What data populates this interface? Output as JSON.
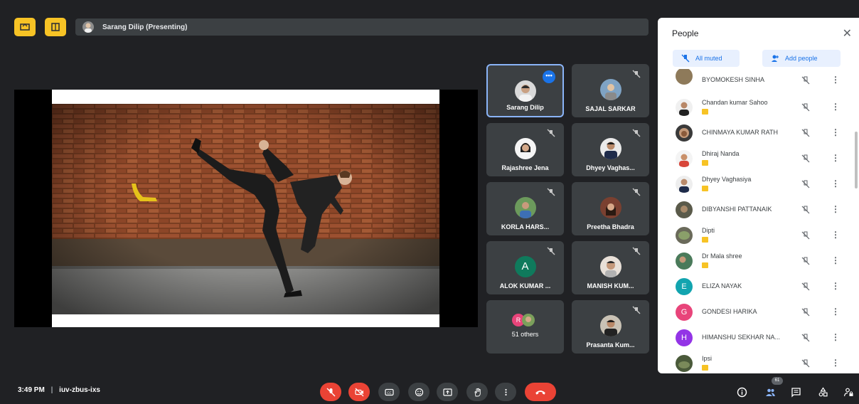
{
  "top_bar": {
    "presenter_label": "Sarang Dilip (Presenting)"
  },
  "tiles": [
    {
      "name": "Sarang Dilip",
      "active": true,
      "more": "•••"
    },
    {
      "name": "SAJAL SARKAR"
    },
    {
      "name": "Rajashree Jena"
    },
    {
      "name": "Dhyey Vaghas..."
    },
    {
      "name": "KORLA HARS..."
    },
    {
      "name": "Preetha Bhadra"
    },
    {
      "name": "ALOK KUMAR ...",
      "initial": "A"
    },
    {
      "name": "MANISH KUM..."
    },
    {
      "name": "51 others",
      "initial": "R"
    },
    {
      "name": "Prasanta Kum..."
    }
  ],
  "people_panel": {
    "title": "People",
    "close_icon": "✕",
    "all_muted_label": "All muted",
    "add_people_label": "Add people",
    "kebab": "⋮",
    "participants": [
      {
        "name": "BYOMOKESH SINHA"
      },
      {
        "name": "Chandan kumar Sahoo"
      },
      {
        "name": "CHINMAYA KUMAR RATH"
      },
      {
        "name": "Dhiraj Nanda"
      },
      {
        "name": "Dhyey Vaghasiya"
      },
      {
        "name": "DIBYANSHI PATTANAIK"
      },
      {
        "name": "Dipti"
      },
      {
        "name": "Dr Mala shree"
      },
      {
        "name": "ELIZA NAYAK",
        "initial": "E",
        "color": "#12a4af"
      },
      {
        "name": "GONDESI HARIKA",
        "initial": "G",
        "color": "#e8447a"
      },
      {
        "name": "HIMANSHU SEKHAR NA...",
        "initial": "H",
        "color": "#9334e6"
      },
      {
        "name": "Ipsi"
      }
    ]
  },
  "bottom_bar": {
    "time": "3:49 PM",
    "separator": "|",
    "meeting_code": "iuv-zbus-ixs",
    "people_count": "61"
  },
  "colors": {
    "background": "#202124",
    "tile": "#3c4043",
    "accent_yellow": "#f7c325",
    "accent_blue": "#1a73e8",
    "danger_red": "#ea4335"
  }
}
